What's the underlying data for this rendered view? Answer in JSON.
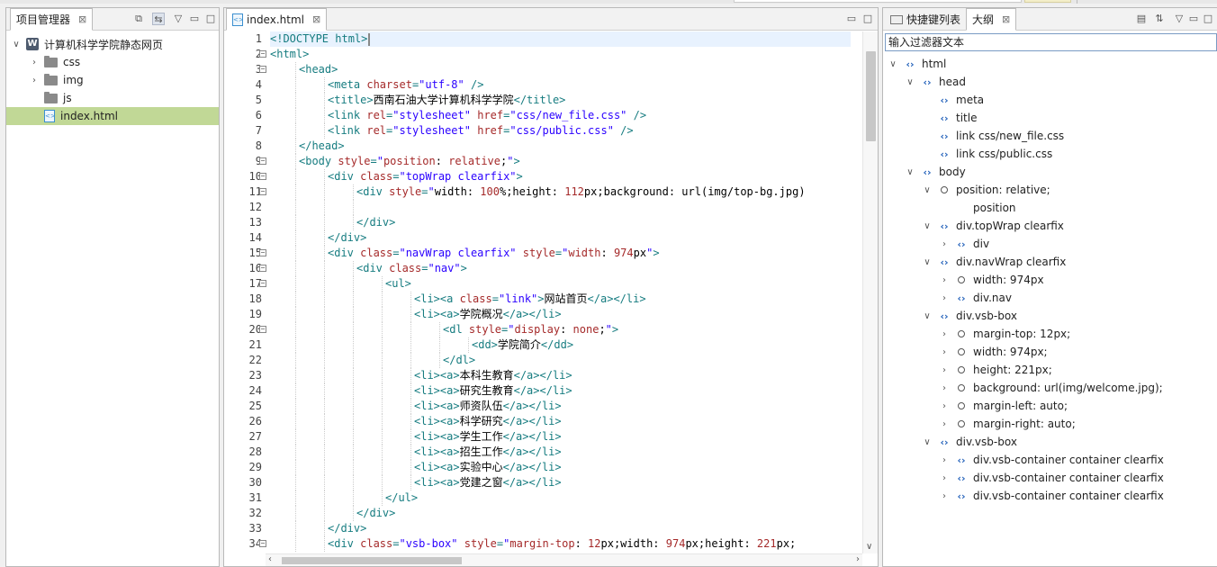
{
  "project_panel": {
    "tab_label": "项目管理器",
    "tree": [
      {
        "label": "计算机科学学院静态网页",
        "type": "project",
        "expanded": true,
        "depth": 0
      },
      {
        "label": "css",
        "type": "folder",
        "expanded": false,
        "depth": 1
      },
      {
        "label": "img",
        "type": "folder",
        "expanded": false,
        "depth": 1
      },
      {
        "label": "js",
        "type": "folder",
        "expanded": false,
        "depth": 1
      },
      {
        "label": "index.html",
        "type": "html",
        "selected": true,
        "depth": 1
      }
    ]
  },
  "editor": {
    "tab_label": "index.html",
    "lines": [
      {
        "n": "1",
        "indent": 0,
        "fold": false,
        "cur": true,
        "tokens": [
          [
            "tg",
            "<!DOCTYPE html>"
          ]
        ]
      },
      {
        "n": "2",
        "indent": 0,
        "fold": true,
        "tokens": [
          [
            "tg",
            "<html>"
          ]
        ]
      },
      {
        "n": "3",
        "indent": 1,
        "fold": true,
        "tokens": [
          [
            "tg",
            "<head>"
          ]
        ]
      },
      {
        "n": "4",
        "indent": 2,
        "fold": false,
        "tokens": [
          [
            "tg",
            "<meta "
          ],
          [
            "at",
            "charset"
          ],
          [
            "tg",
            "="
          ],
          [
            "vl",
            "\"utf-8\""
          ],
          [
            "tg",
            " />"
          ]
        ]
      },
      {
        "n": "5",
        "indent": 2,
        "fold": false,
        "tokens": [
          [
            "tg",
            "<title>"
          ],
          [
            "tx",
            "西南石油大学计算机科学学院"
          ],
          [
            "tg",
            "</title>"
          ]
        ]
      },
      {
        "n": "6",
        "indent": 2,
        "fold": false,
        "tokens": [
          [
            "tg",
            "<link "
          ],
          [
            "at",
            "rel"
          ],
          [
            "tg",
            "="
          ],
          [
            "vl",
            "\"stylesheet\""
          ],
          [
            "tg",
            " "
          ],
          [
            "at",
            "href"
          ],
          [
            "tg",
            "="
          ],
          [
            "vl",
            "\"css/new_file.css\""
          ],
          [
            "tg",
            " />"
          ]
        ]
      },
      {
        "n": "7",
        "indent": 2,
        "fold": false,
        "tokens": [
          [
            "tg",
            "<link "
          ],
          [
            "at",
            "rel"
          ],
          [
            "tg",
            "="
          ],
          [
            "vl",
            "\"stylesheet\""
          ],
          [
            "tg",
            " "
          ],
          [
            "at",
            "href"
          ],
          [
            "tg",
            "="
          ],
          [
            "vl",
            "\"css/public.css\""
          ],
          [
            "tg",
            " />"
          ]
        ]
      },
      {
        "n": "8",
        "indent": 1,
        "fold": false,
        "tokens": [
          [
            "tg",
            "</head>"
          ]
        ]
      },
      {
        "n": "9",
        "indent": 1,
        "fold": true,
        "tokens": [
          [
            "tg",
            "<body "
          ],
          [
            "at",
            "style"
          ],
          [
            "tg",
            "="
          ],
          [
            "vl",
            "\""
          ],
          [
            "at",
            "position"
          ],
          [
            "tx",
            ": "
          ],
          [
            "at",
            "relative"
          ],
          [
            "tx",
            ";"
          ],
          [
            "vl",
            "\""
          ],
          [
            "tg",
            ">"
          ]
        ]
      },
      {
        "n": "10",
        "indent": 2,
        "fold": true,
        "tokens": [
          [
            "tg",
            "<div "
          ],
          [
            "at",
            "class"
          ],
          [
            "tg",
            "="
          ],
          [
            "vl",
            "\"topWrap clearfix\""
          ],
          [
            "tg",
            ">"
          ]
        ]
      },
      {
        "n": "11",
        "indent": 3,
        "fold": true,
        "tokens": [
          [
            "tg",
            "<div "
          ],
          [
            "at",
            "style"
          ],
          [
            "tg",
            "="
          ],
          [
            "vl",
            "\""
          ],
          [
            "tx",
            "width: "
          ],
          [
            "at",
            "100"
          ],
          [
            "tx",
            "%;height: "
          ],
          [
            "at",
            "112"
          ],
          [
            "tx",
            "px;background: url(img/top-bg.jpg)"
          ]
        ]
      },
      {
        "n": "12",
        "indent": 3,
        "fold": false,
        "tokens": []
      },
      {
        "n": "13",
        "indent": 3,
        "fold": false,
        "tokens": [
          [
            "tg",
            "</div>"
          ]
        ]
      },
      {
        "n": "14",
        "indent": 2,
        "fold": false,
        "tokens": [
          [
            "tg",
            "</div>"
          ]
        ]
      },
      {
        "n": "15",
        "indent": 2,
        "fold": true,
        "tokens": [
          [
            "tg",
            "<div "
          ],
          [
            "at",
            "class"
          ],
          [
            "tg",
            "="
          ],
          [
            "vl",
            "\"navWrap clearfix\""
          ],
          [
            "tg",
            " "
          ],
          [
            "at",
            "style"
          ],
          [
            "tg",
            "="
          ],
          [
            "vl",
            "\""
          ],
          [
            "at",
            "width"
          ],
          [
            "tx",
            ": "
          ],
          [
            "at",
            "974"
          ],
          [
            "tx",
            "px"
          ],
          [
            "vl",
            "\""
          ],
          [
            "tg",
            ">"
          ]
        ]
      },
      {
        "n": "16",
        "indent": 3,
        "fold": true,
        "tokens": [
          [
            "tg",
            "<div "
          ],
          [
            "at",
            "class"
          ],
          [
            "tg",
            "="
          ],
          [
            "vl",
            "\"nav\""
          ],
          [
            "tg",
            ">"
          ]
        ]
      },
      {
        "n": "17",
        "indent": 4,
        "fold": true,
        "tokens": [
          [
            "tg",
            "<ul>"
          ]
        ]
      },
      {
        "n": "18",
        "indent": 5,
        "fold": false,
        "tokens": [
          [
            "tg",
            "<li><a "
          ],
          [
            "at",
            "class"
          ],
          [
            "tg",
            "="
          ],
          [
            "vl",
            "\"link\""
          ],
          [
            "tg",
            ">"
          ],
          [
            "tx",
            "网站首页"
          ],
          [
            "tg",
            "</a></li>"
          ]
        ]
      },
      {
        "n": "19",
        "indent": 5,
        "fold": false,
        "tokens": [
          [
            "tg",
            "<li><a>"
          ],
          [
            "tx",
            "学院概况"
          ],
          [
            "tg",
            "</a></li>"
          ]
        ]
      },
      {
        "n": "20",
        "indent": 6,
        "fold": true,
        "tokens": [
          [
            "tg",
            "<dl "
          ],
          [
            "at",
            "style"
          ],
          [
            "tg",
            "="
          ],
          [
            "vl",
            "\""
          ],
          [
            "at",
            "display"
          ],
          [
            "tx",
            ": "
          ],
          [
            "at",
            "none"
          ],
          [
            "tx",
            ";"
          ],
          [
            "vl",
            "\""
          ],
          [
            "tg",
            ">"
          ]
        ]
      },
      {
        "n": "21",
        "indent": 7,
        "fold": false,
        "tokens": [
          [
            "tg",
            "<dd>"
          ],
          [
            "tx",
            "学院简介"
          ],
          [
            "tg",
            "</dd>"
          ]
        ]
      },
      {
        "n": "22",
        "indent": 6,
        "fold": false,
        "tokens": [
          [
            "tg",
            "</dl>"
          ]
        ]
      },
      {
        "n": "23",
        "indent": 5,
        "fold": false,
        "tokens": [
          [
            "tg",
            "<li><a>"
          ],
          [
            "tx",
            "本科生教育"
          ],
          [
            "tg",
            "</a></li>"
          ]
        ]
      },
      {
        "n": "24",
        "indent": 5,
        "fold": false,
        "tokens": [
          [
            "tg",
            "<li><a>"
          ],
          [
            "tx",
            "研究生教育"
          ],
          [
            "tg",
            "</a></li>"
          ]
        ]
      },
      {
        "n": "25",
        "indent": 5,
        "fold": false,
        "tokens": [
          [
            "tg",
            "<li><a>"
          ],
          [
            "tx",
            "师资队伍"
          ],
          [
            "tg",
            "</a></li>"
          ]
        ]
      },
      {
        "n": "26",
        "indent": 5,
        "fold": false,
        "tokens": [
          [
            "tg",
            "<li><a>"
          ],
          [
            "tx",
            "科学研究"
          ],
          [
            "tg",
            "</a></li>"
          ]
        ]
      },
      {
        "n": "27",
        "indent": 5,
        "fold": false,
        "tokens": [
          [
            "tg",
            "<li><a>"
          ],
          [
            "tx",
            "学生工作"
          ],
          [
            "tg",
            "</a></li>"
          ]
        ]
      },
      {
        "n": "28",
        "indent": 5,
        "fold": false,
        "tokens": [
          [
            "tg",
            "<li><a>"
          ],
          [
            "tx",
            "招生工作"
          ],
          [
            "tg",
            "</a></li>"
          ]
        ]
      },
      {
        "n": "29",
        "indent": 5,
        "fold": false,
        "tokens": [
          [
            "tg",
            "<li><a>"
          ],
          [
            "tx",
            "实验中心"
          ],
          [
            "tg",
            "</a></li>"
          ]
        ]
      },
      {
        "n": "30",
        "indent": 5,
        "fold": false,
        "tokens": [
          [
            "tg",
            "<li><a>"
          ],
          [
            "tx",
            "党建之窗"
          ],
          [
            "tg",
            "</a></li>"
          ]
        ]
      },
      {
        "n": "31",
        "indent": 4,
        "fold": false,
        "tokens": [
          [
            "tg",
            "</ul>"
          ]
        ]
      },
      {
        "n": "32",
        "indent": 3,
        "fold": false,
        "tokens": [
          [
            "tg",
            "</div>"
          ]
        ]
      },
      {
        "n": "33",
        "indent": 2,
        "fold": false,
        "tokens": [
          [
            "tg",
            "</div>"
          ]
        ]
      },
      {
        "n": "34",
        "indent": 2,
        "fold": true,
        "tokens": [
          [
            "tg",
            "<div "
          ],
          [
            "at",
            "class"
          ],
          [
            "tg",
            "="
          ],
          [
            "vl",
            "\"vsb-box\""
          ],
          [
            "tg",
            " "
          ],
          [
            "at",
            "style"
          ],
          [
            "tg",
            "="
          ],
          [
            "vl",
            "\""
          ],
          [
            "at",
            "margin-top"
          ],
          [
            "tx",
            ": "
          ],
          [
            "at",
            "12"
          ],
          [
            "tx",
            "px;width: "
          ],
          [
            "at",
            "974"
          ],
          [
            "tx",
            "px;height: "
          ],
          [
            "at",
            "221"
          ],
          [
            "tx",
            "px;"
          ]
        ]
      }
    ]
  },
  "outline_panel": {
    "tab_shortcuts": "快捷键列表",
    "tab_outline": "大纲",
    "filter_placeholder": "输入过滤器文本",
    "tree": [
      {
        "label": "html",
        "depth": 0,
        "kind": "tag",
        "chev": "v"
      },
      {
        "label": "head",
        "depth": 1,
        "kind": "tag",
        "chev": "v"
      },
      {
        "label": "meta",
        "depth": 2,
        "kind": "tag",
        "chev": ""
      },
      {
        "label": "title",
        "depth": 2,
        "kind": "tag",
        "chev": ""
      },
      {
        "label": "link css/new_file.css",
        "depth": 2,
        "kind": "tag",
        "chev": ""
      },
      {
        "label": "link css/public.css",
        "depth": 2,
        "kind": "tag",
        "chev": ""
      },
      {
        "label": "body",
        "depth": 1,
        "kind": "tag",
        "chev": "v"
      },
      {
        "label": "position: relative;",
        "depth": 2,
        "kind": "prop",
        "chev": "v"
      },
      {
        "label": "position",
        "depth": 3,
        "kind": "none",
        "chev": ""
      },
      {
        "label": "div.topWrap clearfix",
        "depth": 2,
        "kind": "tag",
        "chev": "v"
      },
      {
        "label": "div",
        "depth": 3,
        "kind": "tag",
        "chev": ">"
      },
      {
        "label": "div.navWrap clearfix",
        "depth": 2,
        "kind": "tag",
        "chev": "v"
      },
      {
        "label": "width: 974px",
        "depth": 3,
        "kind": "prop",
        "chev": ">"
      },
      {
        "label": "div.nav",
        "depth": 3,
        "kind": "tag",
        "chev": ">"
      },
      {
        "label": "div.vsb-box",
        "depth": 2,
        "kind": "tag",
        "chev": "v"
      },
      {
        "label": "margin-top: 12px;",
        "depth": 3,
        "kind": "prop",
        "chev": ">"
      },
      {
        "label": "width: 974px;",
        "depth": 3,
        "kind": "prop",
        "chev": ">"
      },
      {
        "label": "height: 221px;",
        "depth": 3,
        "kind": "prop",
        "chev": ">"
      },
      {
        "label": "background: url(img/welcome.jpg);",
        "depth": 3,
        "kind": "prop",
        "chev": ">"
      },
      {
        "label": "margin-left: auto;",
        "depth": 3,
        "kind": "prop",
        "chev": ">"
      },
      {
        "label": "margin-right: auto;",
        "depth": 3,
        "kind": "prop",
        "chev": ">"
      },
      {
        "label": "div.vsb-box",
        "depth": 2,
        "kind": "tag",
        "chev": "v"
      },
      {
        "label": "div.vsb-container container clearfix",
        "depth": 3,
        "kind": "tag",
        "chev": ">"
      },
      {
        "label": "div.vsb-container container clearfix",
        "depth": 3,
        "kind": "tag",
        "chev": ">"
      },
      {
        "label": "div.vsb-container container clearfix",
        "depth": 3,
        "kind": "tag",
        "chev": ">"
      }
    ]
  },
  "colors": {
    "selection": "#c1d896",
    "tag": "#167c80",
    "attr": "#a52a2a",
    "value": "#2a00ff",
    "outline_icon": "#2563bb"
  }
}
